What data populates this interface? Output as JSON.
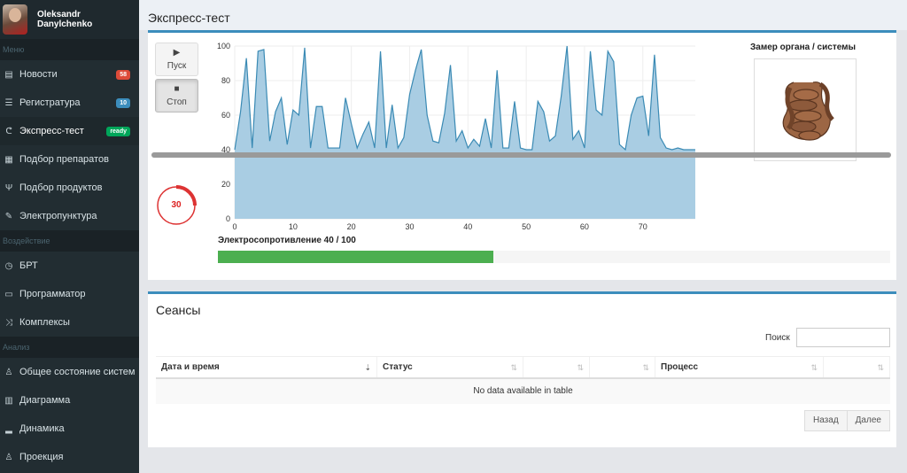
{
  "user": {
    "first_name": "Oleksandr",
    "last_name": "Danylchenko"
  },
  "sidebar": {
    "sections": [
      "Меню",
      "Воздействие",
      "Анализ"
    ],
    "menu": [
      {
        "label": "Новости",
        "icon": "newspaper-icon",
        "badge": "58",
        "badge_color": "#dd4b39"
      },
      {
        "label": "Регистратура",
        "icon": "list-icon",
        "badge": "10",
        "badge_color": "#3c8dbc"
      },
      {
        "label": "Экспресс-тест",
        "icon": "stethoscope-icon",
        "badge": "ready",
        "badge_color": "#00a65a"
      },
      {
        "label": "Подбор препаратов",
        "icon": "table-icon"
      },
      {
        "label": "Подбор продуктов",
        "icon": "cutlery-icon"
      },
      {
        "label": "Электропунктура",
        "icon": "pencil-icon"
      }
    ],
    "impact": [
      {
        "label": "БРТ",
        "icon": "clock-icon"
      },
      {
        "label": "Программатор",
        "icon": "terminal-icon"
      },
      {
        "label": "Комплексы",
        "icon": "shuffle-icon"
      }
    ],
    "analysis": [
      {
        "label": "Общее состояние систем",
        "icon": "person-icon"
      },
      {
        "label": "Диаграмма",
        "icon": "bar-chart-icon"
      },
      {
        "label": "Динамика",
        "icon": "signal-icon"
      },
      {
        "label": "Проекция",
        "icon": "person-icon"
      }
    ]
  },
  "express": {
    "title": "Экспресс-тест",
    "start_label": "Пуск",
    "stop_label": "Стоп",
    "timer": "30",
    "timer_progress": 0.25,
    "organ_title": "Замер органа / системы",
    "progress_label": "Электросопротивление 40 / 100",
    "progress_value": 0.41
  },
  "chart_data": {
    "type": "area",
    "xlim": [
      0,
      79
    ],
    "ylim": [
      0,
      100
    ],
    "xticks": [
      0,
      10,
      20,
      30,
      40,
      50,
      60,
      70
    ],
    "yticks": [
      0,
      20,
      40,
      60,
      80,
      100
    ],
    "grid": true,
    "color": "#3a8ab4",
    "fill": "#a9cde3",
    "x": [
      0,
      1,
      2,
      3,
      4,
      5,
      6,
      7,
      8,
      9,
      10,
      11,
      12,
      13,
      14,
      15,
      16,
      17,
      18,
      19,
      20,
      21,
      22,
      23,
      24,
      25,
      26,
      27,
      28,
      29,
      30,
      31,
      32,
      33,
      34,
      35,
      36,
      37,
      38,
      39,
      40,
      41,
      42,
      43,
      44,
      45,
      46,
      47,
      48,
      49,
      50,
      51,
      52,
      53,
      54,
      55,
      56,
      57,
      58,
      59,
      60,
      61,
      62,
      63,
      64,
      65,
      66,
      67,
      68,
      69,
      70,
      71,
      72,
      73,
      74,
      75,
      76,
      77,
      78,
      79
    ],
    "y": [
      40,
      62,
      93,
      41,
      97,
      98,
      45,
      62,
      70,
      43,
      63,
      60,
      99,
      41,
      65,
      65,
      41,
      41,
      41,
      70,
      55,
      41,
      49,
      56,
      41,
      97,
      41,
      66,
      41,
      47,
      72,
      86,
      98,
      60,
      45,
      44,
      61,
      89,
      45,
      51,
      41,
      46,
      42,
      58,
      41,
      86,
      41,
      41,
      68,
      41,
      40,
      40,
      68,
      62,
      45,
      48,
      71,
      100,
      46,
      51,
      41,
      97,
      63,
      60,
      97,
      91,
      43,
      40,
      60,
      70,
      71,
      48,
      95,
      47,
      41,
      40,
      41,
      40,
      40,
      40
    ]
  },
  "sessions": {
    "title": "Сеансы",
    "search_label": "Поиск",
    "search_value": "",
    "columns": [
      "Дата и время",
      "Статус",
      "",
      "",
      "Процесс",
      ""
    ],
    "empty_text": "No data available in table",
    "prev_label": "Назад",
    "next_label": "Далее"
  }
}
